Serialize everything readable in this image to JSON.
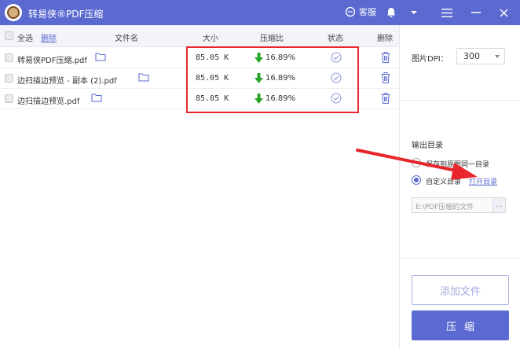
{
  "app": {
    "title": "转易侠®PDF压缩",
    "service_label": "客服"
  },
  "table": {
    "header": {
      "select_all": "全选",
      "delete_link": "删除",
      "filename": "文件名",
      "size": "大小",
      "ratio": "压缩比",
      "status": "状态",
      "delete": "删除"
    },
    "rows": [
      {
        "filename": "转易侠PDF压缩.pdf",
        "size": "85.05 K",
        "ratio": "16.89%"
      },
      {
        "filename": "边扫描边预览 - 副本 (2).pdf",
        "size": "85.05 K",
        "ratio": "16.89%"
      },
      {
        "filename": "边扫描边预览.pdf",
        "size": "85.05 K",
        "ratio": "16.89%"
      }
    ]
  },
  "settings": {
    "dpi_label": "图片DPI：",
    "dpi_value": "300",
    "output_title": "输出目录",
    "option_same": "保存到原图同一目录",
    "option_custom": "自定义目录",
    "open_dir_link": "打开目录",
    "path_value": "E:\\PDF压缩的文件",
    "browse_label": "...",
    "add_files": "添加文件",
    "compress": "压缩"
  },
  "colors": {
    "accent": "#5b6ad0",
    "highlight": "#e8262b",
    "ratio_arrow": "#2aa52a"
  },
  "icons": [
    "logo-icon",
    "headset-icon",
    "bell-icon",
    "caret-down-icon",
    "menu-icon",
    "minimize-icon",
    "close-icon",
    "folder-icon",
    "check-circle-icon",
    "trash-icon",
    "down-arrow-icon"
  ]
}
